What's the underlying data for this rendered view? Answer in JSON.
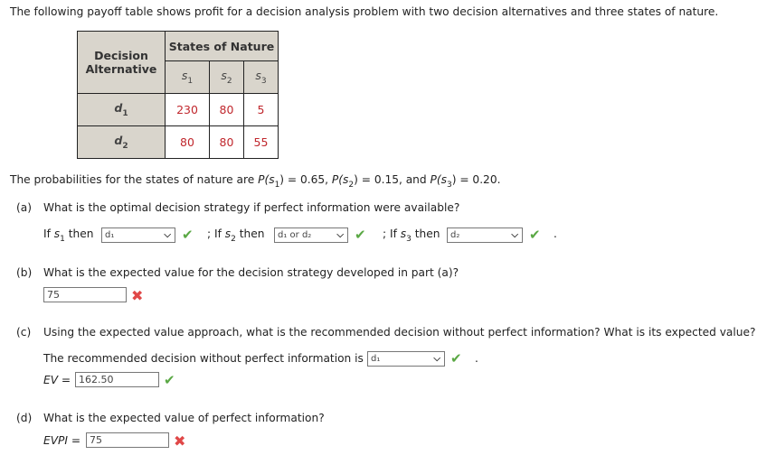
{
  "intro": "The following payoff table shows profit for a decision analysis problem with two decision alternatives and three states of nature.",
  "table": {
    "corner_label_line1": "Decision",
    "corner_label_line2": "Alternative",
    "states_header": "States of Nature",
    "states": [
      {
        "base": "s",
        "sub": "1"
      },
      {
        "base": "s",
        "sub": "2"
      },
      {
        "base": "s",
        "sub": "3"
      }
    ],
    "rows": [
      {
        "base": "d",
        "sub": "1",
        "values": [
          "230",
          "80",
          "5"
        ]
      },
      {
        "base": "d",
        "sub": "2",
        "values": [
          "80",
          "80",
          "55"
        ]
      }
    ],
    "value_color": "#c0272d"
  },
  "probabilities": {
    "prefix": "The probabilities for the states of nature are",
    "p1_label": "P(s",
    "p1_sub": "1",
    "p1_value": ") = 0.65,",
    "p2_label": "P(s",
    "p2_sub": "2",
    "p2_value": ") = 0.15, and",
    "p3_label": "P(s",
    "p3_sub": "3",
    "p3_value": ") = 0.20."
  },
  "part_a": {
    "letter": "(a)",
    "question": "What is the optimal decision strategy if perfect information were available?",
    "if1_prefix": "If s",
    "if1_sub": "1",
    "if1_then": "then",
    "select1": "d₁",
    "sep2_prefix": "; If s",
    "if2_sub": "2",
    "if2_then": "then",
    "select2": "d₁ or d₂",
    "sep3_prefix": "; If s",
    "if3_sub": "3",
    "if3_then": "then",
    "select3": "d₂",
    "end": "."
  },
  "part_b": {
    "letter": "(b)",
    "question": "What is the expected value for the decision strategy developed in part (a)?",
    "answer": "75",
    "status": "incorrect"
  },
  "part_c": {
    "letter": "(c)",
    "question": "Using the expected value approach, what is the recommended decision without perfect information? What is its expected value?",
    "decision_prefix": "The recommended decision without perfect information is",
    "decision_select": "d₁",
    "decision_end": ".",
    "ev_label": "EV",
    "ev_eq": "=",
    "ev_value": "162.50",
    "status": "correct"
  },
  "part_d": {
    "letter": "(d)",
    "question": "What is the expected value of perfect information?",
    "evpi_label": "EVPI",
    "evpi_eq": "=",
    "evpi_value": "75",
    "status": "incorrect"
  },
  "icons": {
    "check": "✔",
    "cross": "✖",
    "chevron": "⌄"
  },
  "colors": {
    "correct": "#5aa844",
    "incorrect": "#e04848",
    "table_header_bg": "#d9d5cc"
  }
}
